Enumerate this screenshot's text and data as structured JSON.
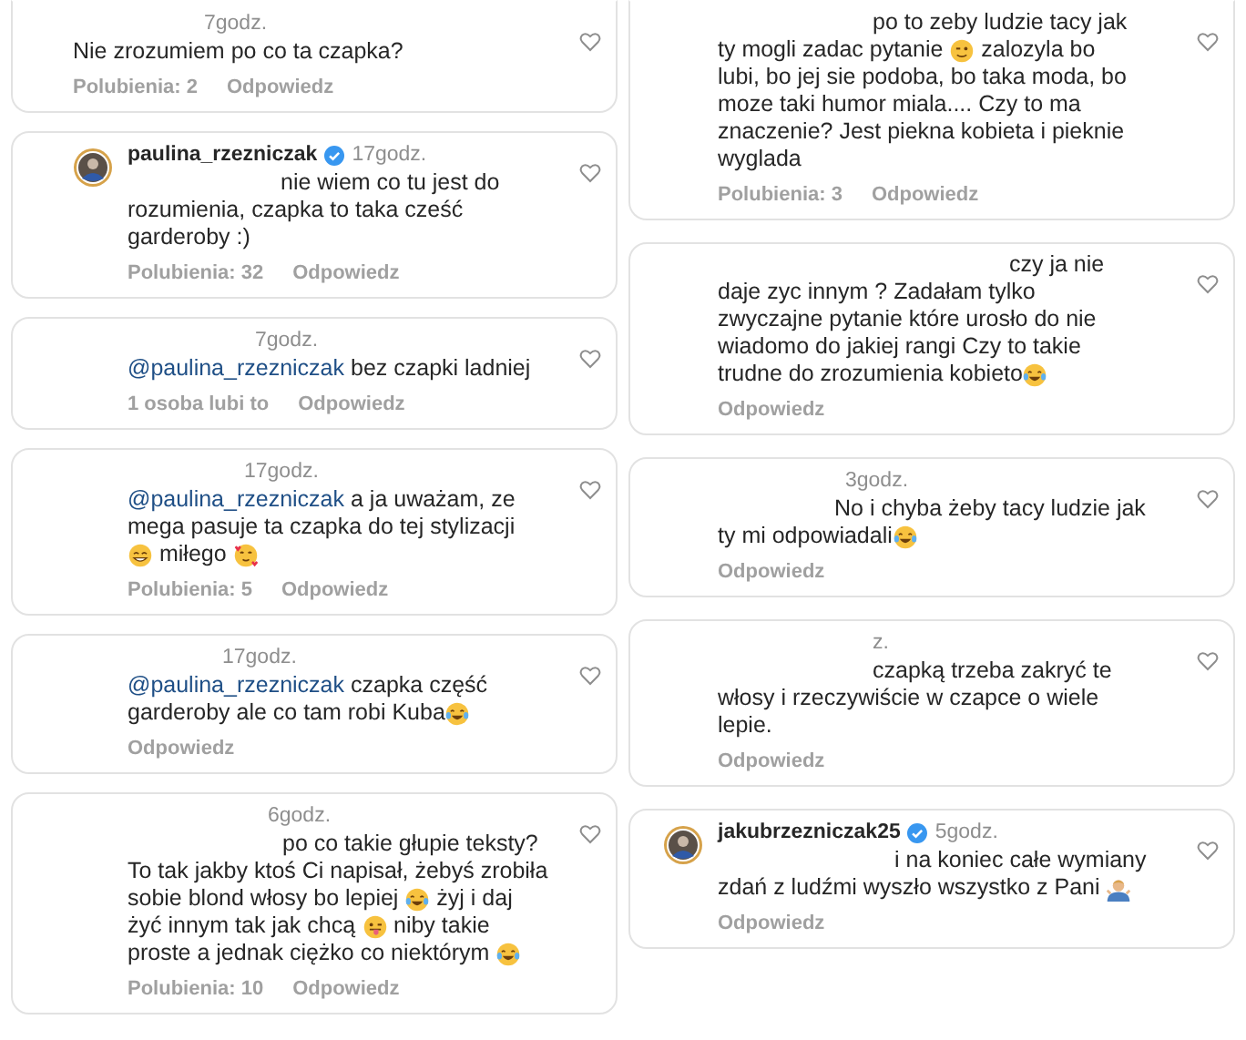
{
  "columns": [
    {
      "comments": [
        {
          "time": "7godz.",
          "lines": [
            [
              "Nie zrozumiem po co ta czapka?"
            ]
          ],
          "likes": "Polubienia: 2",
          "reply": "Odpowiedz",
          "liked": false
        },
        {
          "username": "paulina_rzezniczak",
          "verified": true,
          "time": "17godz.",
          "lines": [
            [
              "nie wiem co tu jest do"
            ],
            [
              "rozumienia, czapka to taka cześć"
            ],
            [
              "garderoby :)"
            ]
          ],
          "likes": "Polubienia: 32",
          "reply": "Odpowiedz",
          "liked": false
        },
        {
          "time": "7godz.",
          "lines": [
            [
              {
                "kind": "mention",
                "text": "@paulina_rzezniczak"
              },
              " bez czapki ladniej"
            ]
          ],
          "likes": "1 osoba lubi to",
          "reply": "Odpowiedz",
          "liked": false
        },
        {
          "time": "17godz.",
          "lines": [
            [
              {
                "kind": "mention",
                "text": "@paulina_rzezniczak"
              },
              " a ja uważam, ze"
            ],
            [
              "mega pasuje ta czapka do tej stylizacji"
            ],
            [
              {
                "kind": "grin"
              },
              " miłego ",
              {
                "kind": "hearts"
              }
            ]
          ],
          "likes": "Polubienia: 5",
          "reply": "Odpowiedz",
          "liked": false
        },
        {
          "time": "17godz.",
          "lines": [
            [
              {
                "kind": "mention",
                "text": "@paulina_rzezniczak"
              },
              " czapka część"
            ],
            [
              "garderoby ale co tam robi Kuba",
              {
                "kind": "laugh"
              }
            ]
          ],
          "reply": "Odpowiedz",
          "liked": false
        },
        {
          "time": "6godz.",
          "lines": [
            [
              "po co takie głupie teksty?"
            ],
            [
              "To tak jakby ktoś Ci napisał, żebyś zrobiła"
            ],
            [
              "sobie blond włosy bo lepiej ",
              {
                "kind": "laugh"
              },
              " żyj i daj"
            ],
            [
              "żyć innym tak jak chcą ",
              {
                "kind": "tongue"
              },
              " niby takie"
            ],
            [
              "proste a jednak ciężko co niektórym ",
              {
                "kind": "laugh"
              }
            ]
          ],
          "likes": "Polubienia: 10",
          "reply": "Odpowiedz",
          "liked": false
        }
      ]
    },
    {
      "comments": [
        {
          "lines": [
            [
              "po to zeby ludzie tacy jak"
            ],
            [
              "ty mogli zadac pytanie ",
              {
                "kind": "wink"
              },
              " zalozyla bo"
            ],
            [
              "lubi, bo jej sie podoba, bo taka moda, bo"
            ],
            [
              "moze taki humor miala.... Czy to ma"
            ],
            [
              "znaczenie? Jest piekna kobieta i pieknie"
            ],
            [
              "wyglada"
            ]
          ],
          "likes": "Polubienia: 3",
          "reply": "Odpowiedz",
          "liked": false
        },
        {
          "lines": [
            [
              "czy ja nie"
            ],
            [
              "daje zyc innym ? Zadałam tylko"
            ],
            [
              "zwyczajne pytanie które urosło do nie"
            ],
            [
              "wiadomo do jakiej rangi Czy to takie"
            ],
            [
              "trudne do zrozumienia kobieto",
              {
                "kind": "laugh"
              }
            ]
          ],
          "reply": "Odpowiedz",
          "liked": false
        },
        {
          "time": "3godz.",
          "lines": [
            [
              "No i chyba żeby tacy ludzie jak"
            ],
            [
              "ty mi odpowiadali",
              {
                "kind": "laugh"
              }
            ]
          ],
          "reply": "Odpowiedz",
          "liked": false
        },
        {
          "time": "z.",
          "lines": [
            [
              "czapką trzeba zakryć te"
            ],
            [
              "włosy i rzeczywiście w czapce o wiele"
            ],
            [
              "lepie."
            ]
          ],
          "reply": "Odpowiedz",
          "liked": false
        },
        {
          "username": "jakubrzezniczak25",
          "verified": true,
          "time": "5godz.",
          "lines": [
            [
              "i na koniec całe wymiany"
            ],
            [
              "zdań z ludźmi wyszło wszystko z Pani ",
              {
                "kind": "shrug"
              }
            ]
          ],
          "reply": "Odpowiedz",
          "liked": false
        }
      ]
    }
  ]
}
